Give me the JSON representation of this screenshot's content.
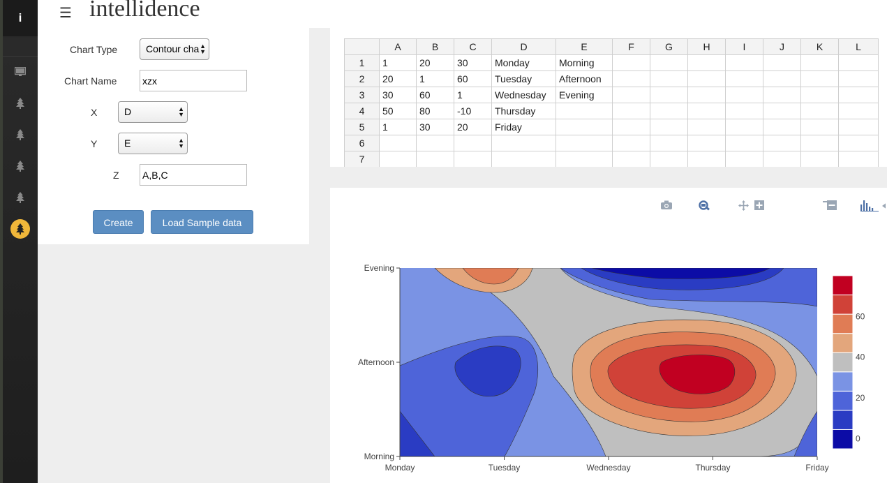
{
  "app": {
    "logo_letter": "i",
    "brand": "intellidence"
  },
  "colors": {
    "accent": "#5b8ec2",
    "active_nav": "#f0b73a"
  },
  "sidebar": {
    "items": [
      {
        "icon": "monitor-icon"
      },
      {
        "icon": "tree-icon"
      },
      {
        "icon": "tree-icon"
      },
      {
        "icon": "tree-icon"
      },
      {
        "icon": "tree-icon"
      },
      {
        "icon": "tree-icon",
        "active": true
      }
    ]
  },
  "form": {
    "chart_type_label": "Chart Type",
    "chart_type_value": "Contour cha",
    "chart_name_label": "Chart Name",
    "chart_name_value": "xzx",
    "x_label": "X",
    "x_value": "D",
    "y_label": "Y",
    "y_value": "E",
    "z_label": "Z",
    "z_value": "A,B,C",
    "create_label": "Create",
    "load_label": "Load Sample data"
  },
  "sheet": {
    "columns": [
      "A",
      "B",
      "C",
      "D",
      "E",
      "F",
      "G",
      "H",
      "I",
      "J",
      "K",
      "L"
    ],
    "rows": [
      {
        "num": "1",
        "cells": [
          "1",
          "20",
          "30",
          "Monday",
          "Morning",
          "",
          "",
          "",
          "",
          "",
          "",
          ""
        ]
      },
      {
        "num": "2",
        "cells": [
          "20",
          "1",
          "60",
          "Tuesday",
          "Afternoon",
          "",
          "",
          "",
          "",
          "",
          "",
          ""
        ]
      },
      {
        "num": "3",
        "cells": [
          "30",
          "60",
          "1",
          "Wednesday",
          "Evening",
          "",
          "",
          "",
          "",
          "",
          "",
          ""
        ]
      },
      {
        "num": "4",
        "cells": [
          "50",
          "80",
          "-10",
          "Thursday",
          "",
          "",
          "",
          "",
          "",
          "",
          "",
          ""
        ]
      },
      {
        "num": "5",
        "cells": [
          "1",
          "30",
          "20",
          "Friday",
          "",
          "",
          "",
          "",
          "",
          "",
          "",
          ""
        ]
      },
      {
        "num": "6",
        "cells": [
          "",
          "",
          "",
          "",
          "",
          "",
          "",
          "",
          "",
          "",
          "",
          ""
        ]
      },
      {
        "num": "7",
        "cells": [
          "",
          "",
          "",
          "",
          "",
          "",
          "",
          "",
          "",
          "",
          "",
          ""
        ]
      }
    ]
  },
  "toolbar": [
    "camera-icon",
    "zoom-icon",
    "pan-icon",
    "zoom-in-icon",
    "zoom-out-icon",
    "bar-chart-icon"
  ],
  "chart_data": {
    "type": "heatmap",
    "x": [
      "Monday",
      "Tuesday",
      "Wednesday",
      "Thursday",
      "Friday"
    ],
    "y": [
      "Morning",
      "Afternoon",
      "Evening"
    ],
    "colorbar_ticks": [
      "0",
      "20",
      "40",
      "60"
    ],
    "colorscale": [
      "#0c0ca6",
      "#2a3cc3",
      "#4e64d9",
      "#7a93e4",
      "#bfbfbf",
      "#e3a67c",
      "#e07c55",
      "#d04238",
      "#c10021"
    ]
  }
}
